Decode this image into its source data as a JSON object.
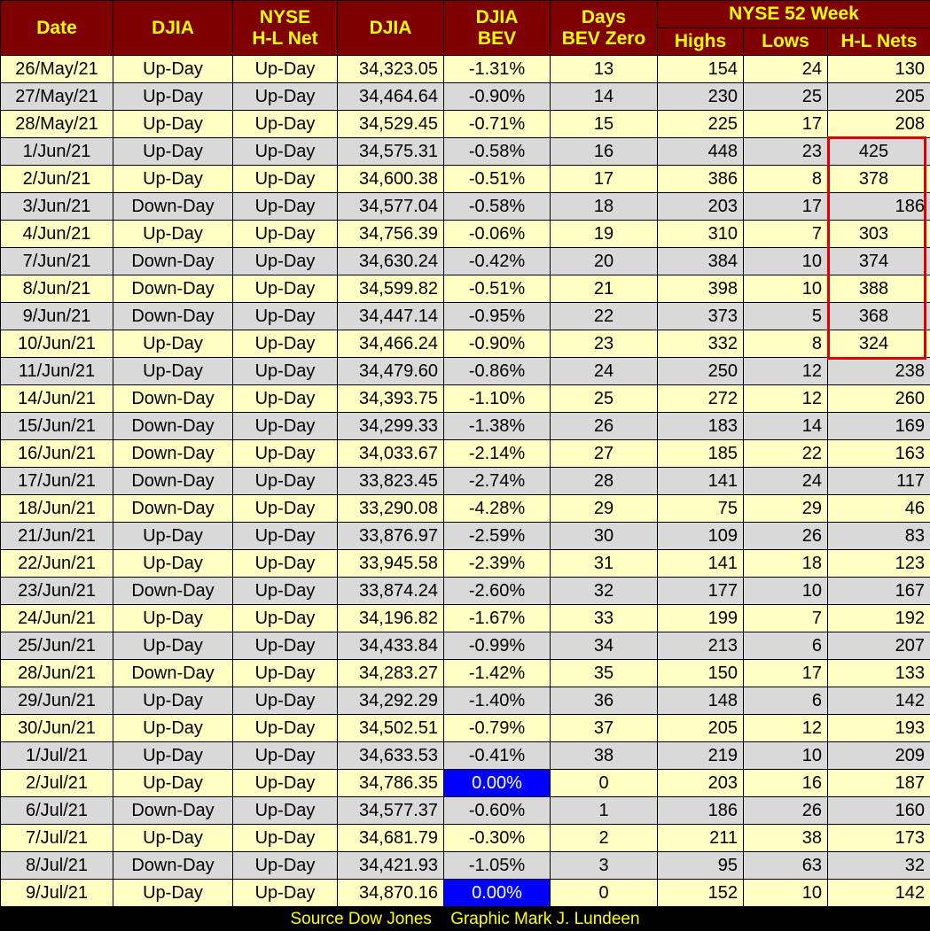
{
  "header": {
    "date": "Date",
    "djia_dir": "DJIA",
    "nyse_line1": "NYSE",
    "nyse_line2": "H-L Net",
    "djia": "DJIA",
    "bev_line1": "DJIA",
    "bev_line2": "BEV",
    "days_line1": "Days",
    "days_line2": "BEV Zero",
    "group52": "NYSE 52 Week",
    "highs": "Highs",
    "lows": "Lows",
    "nets": "H-L Nets"
  },
  "rows": [
    {
      "date": "26/May/21",
      "djia_dir": "Up-Day",
      "nyse_dir": "Up-Day",
      "djia": "34,323.05",
      "bev": "-1.31%",
      "days": "13",
      "highs": "154",
      "lows": "24",
      "nets": "130"
    },
    {
      "date": "27/May/21",
      "djia_dir": "Up-Day",
      "nyse_dir": "Up-Day",
      "djia": "34,464.64",
      "bev": "-0.90%",
      "days": "14",
      "highs": "230",
      "lows": "25",
      "nets": "205"
    },
    {
      "date": "28/May/21",
      "djia_dir": "Up-Day",
      "nyse_dir": "Up-Day",
      "djia": "34,529.45",
      "bev": "-0.71%",
      "days": "15",
      "highs": "225",
      "lows": "17",
      "nets": "208"
    },
    {
      "date": "1/Jun/21",
      "djia_dir": "Up-Day",
      "nyse_dir": "Up-Day",
      "djia": "34,575.31",
      "bev": "-0.58%",
      "days": "16",
      "highs": "448",
      "lows": "23",
      "nets": "425"
    },
    {
      "date": "2/Jun/21",
      "djia_dir": "Up-Day",
      "nyse_dir": "Up-Day",
      "djia": "34,600.38",
      "bev": "-0.51%",
      "days": "17",
      "highs": "386",
      "lows": "8",
      "nets": "378"
    },
    {
      "date": "3/Jun/21",
      "djia_dir": "Down-Day",
      "nyse_dir": "Up-Day",
      "djia": "34,577.04",
      "bev": "-0.58%",
      "days": "18",
      "highs": "203",
      "lows": "17",
      "nets": "186"
    },
    {
      "date": "4/Jun/21",
      "djia_dir": "Up-Day",
      "nyse_dir": "Up-Day",
      "djia": "34,756.39",
      "bev": "-0.06%",
      "days": "19",
      "highs": "310",
      "lows": "7",
      "nets": "303"
    },
    {
      "date": "7/Jun/21",
      "djia_dir": "Down-Day",
      "nyse_dir": "Up-Day",
      "djia": "34,630.24",
      "bev": "-0.42%",
      "days": "20",
      "highs": "384",
      "lows": "10",
      "nets": "374"
    },
    {
      "date": "8/Jun/21",
      "djia_dir": "Down-Day",
      "nyse_dir": "Up-Day",
      "djia": "34,599.82",
      "bev": "-0.51%",
      "days": "21",
      "highs": "398",
      "lows": "10",
      "nets": "388"
    },
    {
      "date": "9/Jun/21",
      "djia_dir": "Down-Day",
      "nyse_dir": "Up-Day",
      "djia": "34,447.14",
      "bev": "-0.95%",
      "days": "22",
      "highs": "373",
      "lows": "5",
      "nets": "368"
    },
    {
      "date": "10/Jun/21",
      "djia_dir": "Up-Day",
      "nyse_dir": "Up-Day",
      "djia": "34,466.24",
      "bev": "-0.90%",
      "days": "23",
      "highs": "332",
      "lows": "8",
      "nets": "324"
    },
    {
      "date": "11/Jun/21",
      "djia_dir": "Up-Day",
      "nyse_dir": "Up-Day",
      "djia": "34,479.60",
      "bev": "-0.86%",
      "days": "24",
      "highs": "250",
      "lows": "12",
      "nets": "238"
    },
    {
      "date": "14/Jun/21",
      "djia_dir": "Down-Day",
      "nyse_dir": "Up-Day",
      "djia": "34,393.75",
      "bev": "-1.10%",
      "days": "25",
      "highs": "272",
      "lows": "12",
      "nets": "260"
    },
    {
      "date": "15/Jun/21",
      "djia_dir": "Down-Day",
      "nyse_dir": "Up-Day",
      "djia": "34,299.33",
      "bev": "-1.38%",
      "days": "26",
      "highs": "183",
      "lows": "14",
      "nets": "169"
    },
    {
      "date": "16/Jun/21",
      "djia_dir": "Down-Day",
      "nyse_dir": "Up-Day",
      "djia": "34,033.67",
      "bev": "-2.14%",
      "days": "27",
      "highs": "185",
      "lows": "22",
      "nets": "163"
    },
    {
      "date": "17/Jun/21",
      "djia_dir": "Down-Day",
      "nyse_dir": "Up-Day",
      "djia": "33,823.45",
      "bev": "-2.74%",
      "days": "28",
      "highs": "141",
      "lows": "24",
      "nets": "117"
    },
    {
      "date": "18/Jun/21",
      "djia_dir": "Down-Day",
      "nyse_dir": "Up-Day",
      "djia": "33,290.08",
      "bev": "-4.28%",
      "days": "29",
      "highs": "75",
      "lows": "29",
      "nets": "46"
    },
    {
      "date": "21/Jun/21",
      "djia_dir": "Up-Day",
      "nyse_dir": "Up-Day",
      "djia": "33,876.97",
      "bev": "-2.59%",
      "days": "30",
      "highs": "109",
      "lows": "26",
      "nets": "83"
    },
    {
      "date": "22/Jun/21",
      "djia_dir": "Up-Day",
      "nyse_dir": "Up-Day",
      "djia": "33,945.58",
      "bev": "-2.39%",
      "days": "31",
      "highs": "141",
      "lows": "18",
      "nets": "123"
    },
    {
      "date": "23/Jun/21",
      "djia_dir": "Down-Day",
      "nyse_dir": "Up-Day",
      "djia": "33,874.24",
      "bev": "-2.60%",
      "days": "32",
      "highs": "177",
      "lows": "10",
      "nets": "167"
    },
    {
      "date": "24/Jun/21",
      "djia_dir": "Up-Day",
      "nyse_dir": "Up-Day",
      "djia": "34,196.82",
      "bev": "-1.67%",
      "days": "33",
      "highs": "199",
      "lows": "7",
      "nets": "192"
    },
    {
      "date": "25/Jun/21",
      "djia_dir": "Up-Day",
      "nyse_dir": "Up-Day",
      "djia": "34,433.84",
      "bev": "-0.99%",
      "days": "34",
      "highs": "213",
      "lows": "6",
      "nets": "207"
    },
    {
      "date": "28/Jun/21",
      "djia_dir": "Down-Day",
      "nyse_dir": "Up-Day",
      "djia": "34,283.27",
      "bev": "-1.42%",
      "days": "35",
      "highs": "150",
      "lows": "17",
      "nets": "133"
    },
    {
      "date": "29/Jun/21",
      "djia_dir": "Up-Day",
      "nyse_dir": "Up-Day",
      "djia": "34,292.29",
      "bev": "-1.40%",
      "days": "36",
      "highs": "148",
      "lows": "6",
      "nets": "142"
    },
    {
      "date": "30/Jun/21",
      "djia_dir": "Up-Day",
      "nyse_dir": "Up-Day",
      "djia": "34,502.51",
      "bev": "-0.79%",
      "days": "37",
      "highs": "205",
      "lows": "12",
      "nets": "193"
    },
    {
      "date": "1/Jul/21",
      "djia_dir": "Up-Day",
      "nyse_dir": "Up-Day",
      "djia": "34,633.53",
      "bev": "-0.41%",
      "days": "38",
      "highs": "219",
      "lows": "10",
      "nets": "209"
    },
    {
      "date": "2/Jul/21",
      "djia_dir": "Up-Day",
      "nyse_dir": "Up-Day",
      "djia": "34,786.35",
      "bev": "0.00%",
      "days": "0",
      "highs": "203",
      "lows": "16",
      "nets": "187"
    },
    {
      "date": "6/Jul/21",
      "djia_dir": "Down-Day",
      "nyse_dir": "Up-Day",
      "djia": "34,577.37",
      "bev": "-0.60%",
      "days": "1",
      "highs": "186",
      "lows": "26",
      "nets": "160"
    },
    {
      "date": "7/Jul/21",
      "djia_dir": "Up-Day",
      "nyse_dir": "Up-Day",
      "djia": "34,681.79",
      "bev": "-0.30%",
      "days": "2",
      "highs": "211",
      "lows": "38",
      "nets": "173"
    },
    {
      "date": "8/Jul/21",
      "djia_dir": "Down-Day",
      "nyse_dir": "Up-Day",
      "djia": "34,421.93",
      "bev": "-1.05%",
      "days": "3",
      "highs": "95",
      "lows": "63",
      "nets": "32"
    },
    {
      "date": "9/Jul/21",
      "djia_dir": "Up-Day",
      "nyse_dir": "Up-Day",
      "djia": "34,870.16",
      "bev": "0.00%",
      "days": "0",
      "highs": "152",
      "lows": "10",
      "nets": "142"
    }
  ],
  "footer": {
    "source": "Source Dow Jones",
    "graphic": "Graphic Mark J. Lundeen"
  },
  "colors": {
    "header_bg": "#7f0000",
    "header_text": "#ffff00",
    "row_odd": "#ffffc4",
    "row_even": "#d9d9d9",
    "bev_zero_highlight": "#0000ff",
    "box_outline": "#e00000"
  }
}
